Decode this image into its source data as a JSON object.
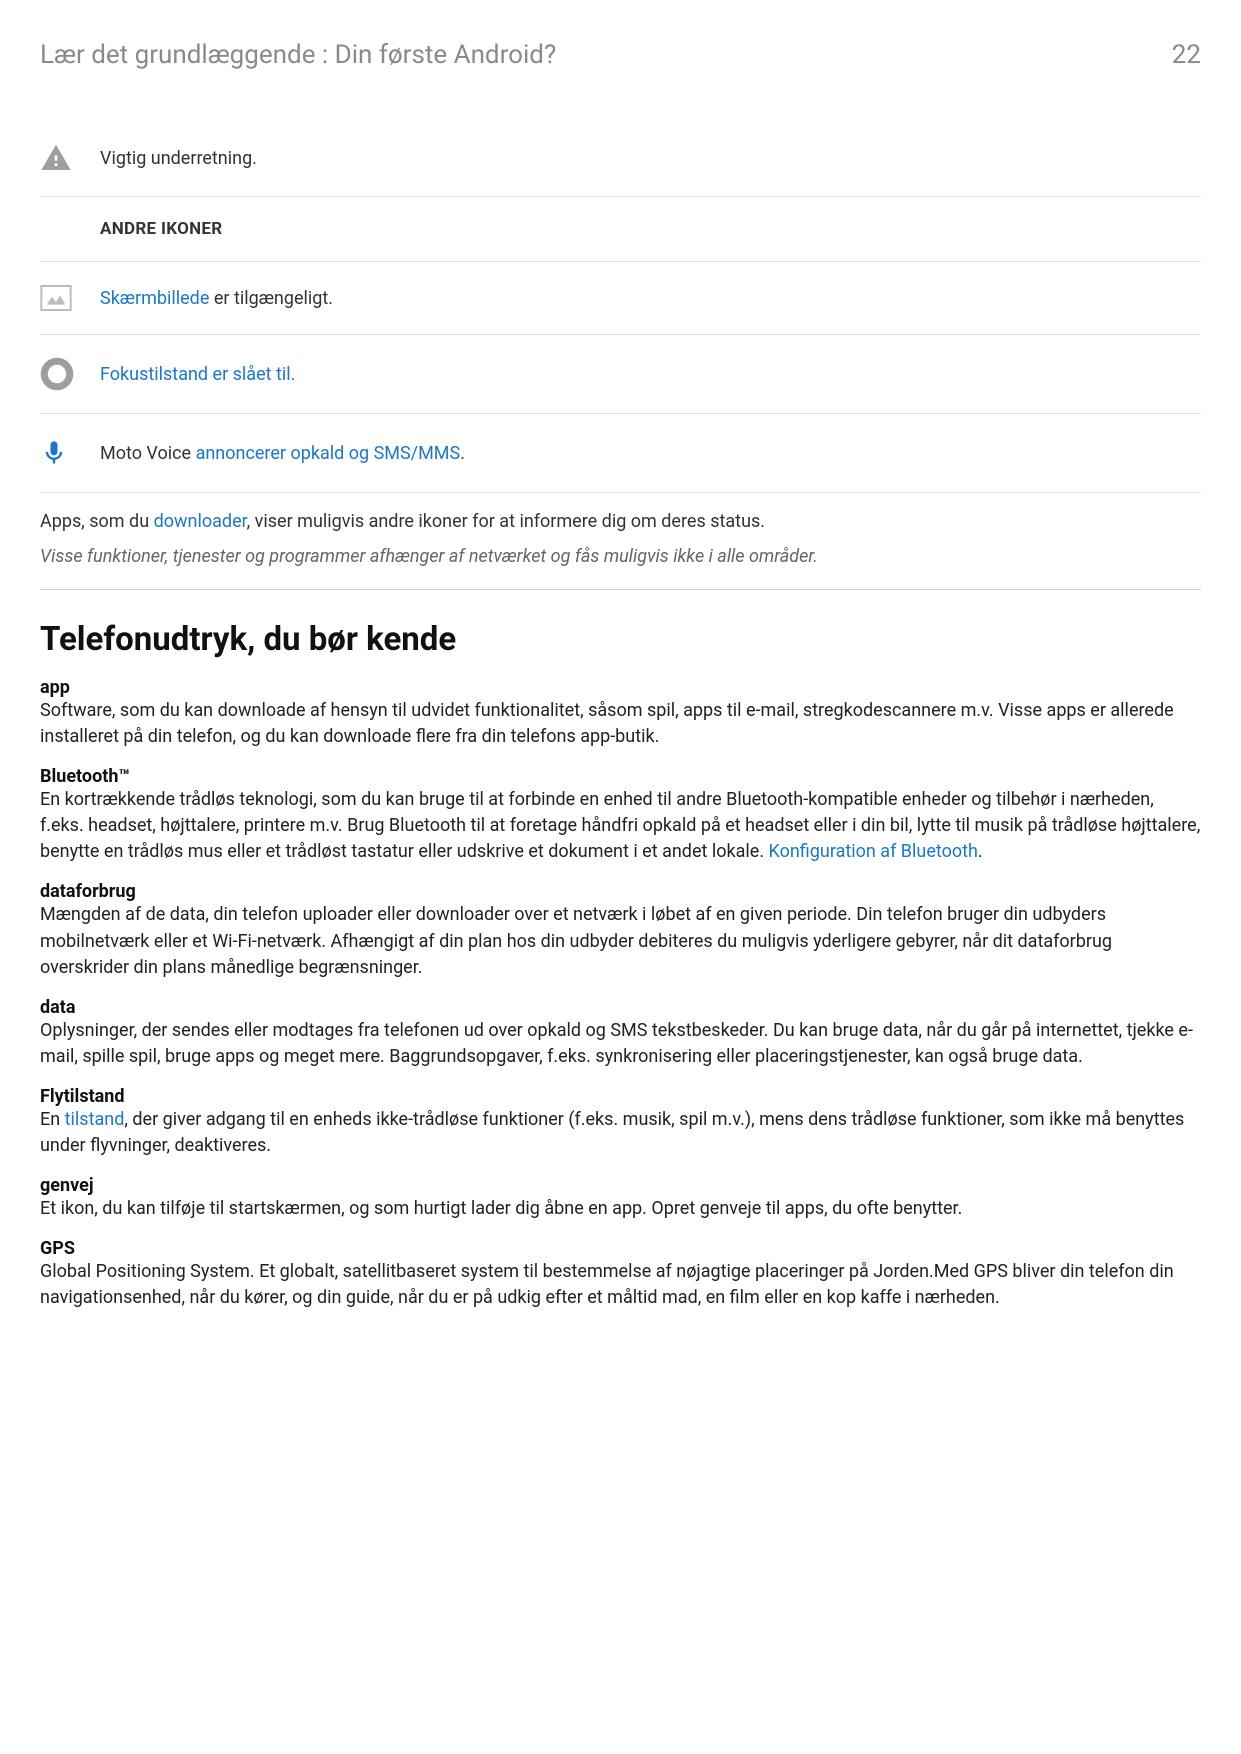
{
  "header": {
    "breadcrumb": "Lær det grundlæggende : Din første Android?",
    "page_number": "22"
  },
  "icon_rows": {
    "warning_text": "Vigtig underretning.",
    "sub_header": "ANDRE IKONER",
    "screenshot_link": "Skærmbillede",
    "screenshot_rest": " er tilgængeligt.",
    "focus_link": "Fokustilstand er slået til.",
    "voice_prefix": "Moto Voice ",
    "voice_link": "annoncerer opkald og SMS/MMS",
    "voice_suffix": "."
  },
  "notes": {
    "apps_prefix": "Apps, som du ",
    "apps_link": "downloader",
    "apps_suffix": ", viser muligvis andre ikoner for at informere dig om deres status.",
    "italic": "Visse funktioner, tjenester og programmer afhænger af netværket og fås muligvis ikke i alle områder."
  },
  "section": {
    "title": "Telefonudtryk, du bør kende"
  },
  "terms": {
    "app": {
      "title": "app",
      "body": "Software, som du kan downloade af hensyn til udvidet funktionalitet, såsom spil, apps til e-mail, stregkodescannere m.v. Visse apps er allerede installeret på din telefon, og du kan downloade flere fra din telefons app-butik."
    },
    "bluetooth": {
      "title": "Bluetooth™",
      "body_1": "En kortrækkende trådløs teknologi, som du kan bruge til at forbinde en enhed til andre Bluetooth-kompatible enheder og tilbehør i nærheden, f.eks. headset, højttalere, printere m.v. Brug Bluetooth til at foretage håndfri opkald på et headset eller i din bil, lytte til musik på trådløse højttalere, benytte en trådløs mus eller et trådløst tastatur eller udskrive et dokument i et andet lokale. ",
      "body_link": "Konfiguration af Bluetooth",
      "body_2": "."
    },
    "dataforbrug": {
      "title": "dataforbrug",
      "body": "Mængden af de data, din telefon uploader eller downloader over et netværk i løbet af en given periode. Din telefon bruger din udbyders mobilnetværk eller et Wi-Fi-netværk. Afhængigt af din plan hos din udbyder debiteres du muligvis yderligere gebyrer, når dit dataforbrug overskrider din plans månedlige begrænsninger."
    },
    "data": {
      "title": "data",
      "body": "Oplysninger, der sendes eller modtages fra telefonen ud over opkald og SMS tekstbeskeder. Du kan bruge data, når du går på internettet, tjekke e-mail, spille spil, bruge apps og meget mere. Baggrundsopgaver, f.eks. synkronisering eller placeringstjenester, kan også bruge data."
    },
    "flytilstand": {
      "title": "Flytilstand",
      "body_1": "En ",
      "body_link": "tilstand",
      "body_2": ", der giver adgang til en enheds ikke-trådløse funktioner (f.eks. musik, spil m.v.), mens dens trådløse funktioner, som ikke må benyttes under flyvninger, deaktiveres."
    },
    "genvej": {
      "title": "genvej",
      "body": "Et ikon, du kan tilføje til startskærmen, og som hurtigt lader dig åbne en app. Opret genveje til apps, du ofte benytter."
    },
    "gps": {
      "title": "GPS",
      "body": "Global Positioning System. Et globalt, satellitbaseret system til bestemmelse af nøjagtige placeringer på Jorden.Med GPS bliver din telefon din navigationsenhed, når du kører, og din guide, når du er på udkig efter et måltid mad, en film eller en kop kaffe i nærheden."
    }
  }
}
